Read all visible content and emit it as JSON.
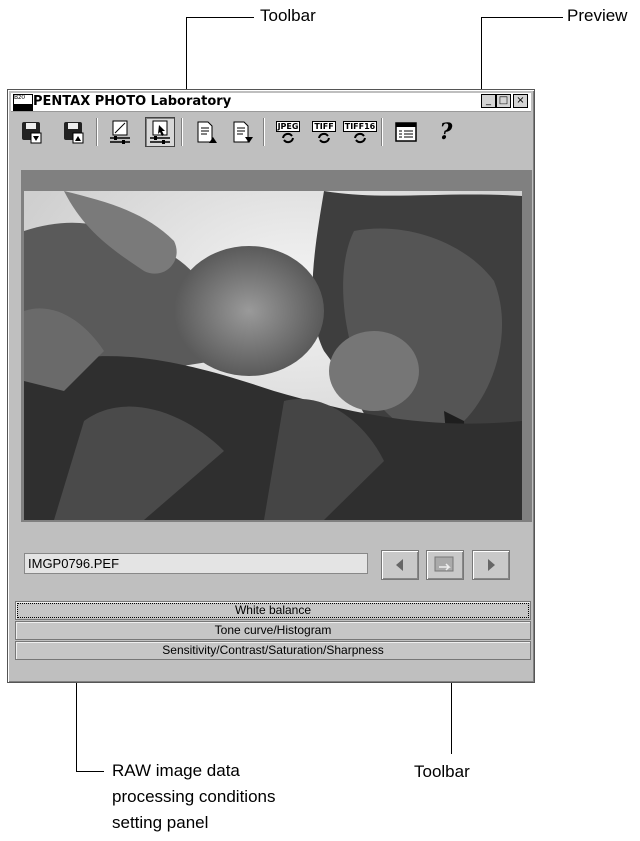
{
  "callouts": {
    "toolbar_top": "Toolbar",
    "preview": "Preview",
    "panel_line1": "RAW image data",
    "panel_line2": "processing conditions",
    "panel_line3": "setting panel",
    "toolbar_bottom": "Toolbar"
  },
  "window": {
    "title": "PENTAX PHOTO Laboratory",
    "app_icon_text": "Bz0",
    "minimize": "_",
    "maximize": "□",
    "close": "×"
  },
  "toolbar": {
    "items": [
      {
        "icon": "save-down-icon"
      },
      {
        "icon": "save-up-icon"
      },
      {
        "icon": "adjust-settings-icon"
      },
      {
        "icon": "adjust-settings-active-icon",
        "pressed": true
      },
      {
        "icon": "document-up-icon"
      },
      {
        "icon": "document-down-icon"
      },
      {
        "icon": "jpeg-convert-icon",
        "label": "JPEG"
      },
      {
        "icon": "tiff-convert-icon",
        "label": "TIFF"
      },
      {
        "icon": "tiff16-convert-icon",
        "label": "TIFF16"
      },
      {
        "icon": "properties-icon"
      },
      {
        "icon": "help-icon",
        "label": "?"
      }
    ]
  },
  "file": {
    "name": "IMGP0796.PEF"
  },
  "nav": {
    "prev_icon": "arrow-left-icon",
    "apply_icon": "apply-icon",
    "next_icon": "arrow-right-icon"
  },
  "panels": [
    {
      "label": "White balance",
      "focused": true
    },
    {
      "label": "Tone curve/Histogram"
    },
    {
      "label": "Sensitivity/Contrast/Saturation/Sharpness"
    }
  ]
}
